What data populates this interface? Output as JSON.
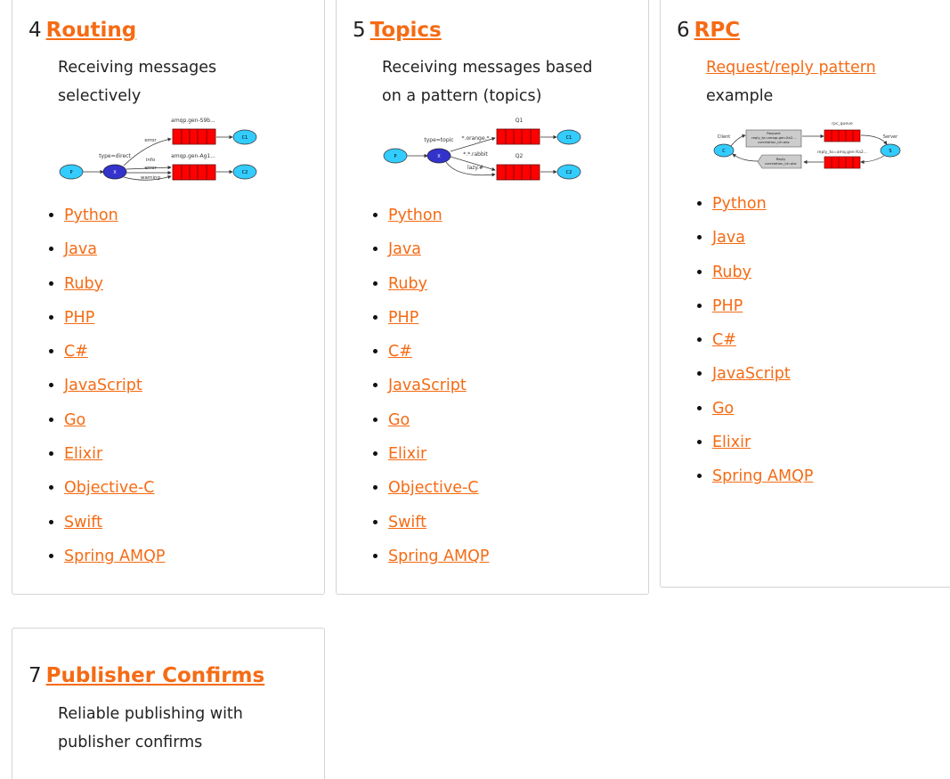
{
  "tutorials": [
    {
      "number": "4",
      "title": "Routing",
      "description": "Receiving messages selectively",
      "diagram": {
        "queue1": "amqp.gen-S9b...",
        "queue2": "amqp.gen-Ag1...",
        "exchange_type": "type=direct",
        "keys": [
          "error",
          "info",
          "error",
          "warning"
        ],
        "producer": "P",
        "exchange": "X",
        "consumer1": "C1",
        "consumer2": "C2"
      },
      "languages": [
        "Python",
        "Java",
        "Ruby",
        "PHP",
        "C#",
        "JavaScript",
        "Go",
        "Elixir",
        "Objective-C",
        "Swift",
        "Spring AMQP"
      ]
    },
    {
      "number": "5",
      "title": "Topics",
      "description": "Receiving messages based on a pattern (topics)",
      "diagram": {
        "queue1": "Q1",
        "queue2": "Q2",
        "exchange_type": "type=topic",
        "keys": [
          "*.orange.*",
          "*.*.rabbit",
          "lazy.#"
        ],
        "producer": "P",
        "exchange": "X",
        "consumer1": "C1",
        "consumer2": "C2"
      },
      "languages": [
        "Python",
        "Java",
        "Ruby",
        "PHP",
        "C#",
        "JavaScript",
        "Go",
        "Elixir",
        "Objective-C",
        "Swift",
        "Spring AMQP"
      ]
    },
    {
      "number": "6",
      "title": "RPC",
      "description_link": "Request/reply pattern",
      "description_rest": "example",
      "diagram": {
        "client": "Client",
        "server": "Server",
        "queue1": "rpc_queue",
        "queue2": "reply_to=amq.gen-Xa2...",
        "request_title": "Request",
        "request_line1": "reply_to=amqp.gen-Xa2...",
        "request_line2": "correlation_id=abc",
        "reply_title": "Reply",
        "reply_line": "correlation_id=abc",
        "client_node": "C",
        "server_node": "S"
      },
      "languages": [
        "Python",
        "Java",
        "Ruby",
        "PHP",
        "C#",
        "JavaScript",
        "Go",
        "Elixir",
        "Spring AMQP"
      ]
    },
    {
      "number": "7",
      "title": "Publisher Confirms",
      "description": "Reliable publishing with publisher confirms"
    }
  ],
  "colors": {
    "accent": "#f56b14",
    "queue_red": "#ff0000",
    "exchange_blue": "#3333cc",
    "node_cyan": "#33ccff"
  }
}
